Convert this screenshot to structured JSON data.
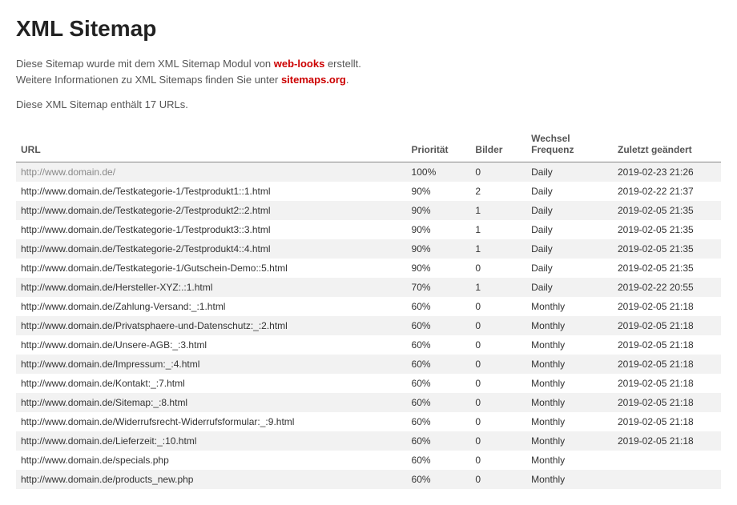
{
  "title": "XML Sitemap",
  "intro": {
    "line1_pre": "Diese Sitemap wurde mit dem XML Sitemap Modul von ",
    "link1": "web-looks",
    "line1_post": " erstellt.",
    "line2_pre": "Weitere Informationen zu XML Sitemaps finden Sie unter ",
    "link2": "sitemaps.org",
    "line2_post": "."
  },
  "count_text": "Diese XML Sitemap enthält 17 URLs.",
  "columns": {
    "url": "URL",
    "priority": "Priorität",
    "bilder": "Bilder",
    "freq": "Wechsel Frequenz",
    "changed": "Zuletzt geändert"
  },
  "rows": [
    {
      "url": "http://www.domain.de/",
      "priority": "100%",
      "bilder": "0",
      "freq": "Daily",
      "changed": "2019-02-23 21:26"
    },
    {
      "url": "http://www.domain.de/Testkategorie-1/Testprodukt1::1.html",
      "priority": "90%",
      "bilder": "2",
      "freq": "Daily",
      "changed": "2019-02-22 21:37"
    },
    {
      "url": "http://www.domain.de/Testkategorie-2/Testprodukt2::2.html",
      "priority": "90%",
      "bilder": "1",
      "freq": "Daily",
      "changed": "2019-02-05 21:35"
    },
    {
      "url": "http://www.domain.de/Testkategorie-1/Testprodukt3::3.html",
      "priority": "90%",
      "bilder": "1",
      "freq": "Daily",
      "changed": "2019-02-05 21:35"
    },
    {
      "url": "http://www.domain.de/Testkategorie-2/Testprodukt4::4.html",
      "priority": "90%",
      "bilder": "1",
      "freq": "Daily",
      "changed": "2019-02-05 21:35"
    },
    {
      "url": "http://www.domain.de/Testkategorie-1/Gutschein-Demo::5.html",
      "priority": "90%",
      "bilder": "0",
      "freq": "Daily",
      "changed": "2019-02-05 21:35"
    },
    {
      "url": "http://www.domain.de/Hersteller-XYZ:.:1.html",
      "priority": "70%",
      "bilder": "1",
      "freq": "Daily",
      "changed": "2019-02-22 20:55"
    },
    {
      "url": "http://www.domain.de/Zahlung-Versand:_:1.html",
      "priority": "60%",
      "bilder": "0",
      "freq": "Monthly",
      "changed": "2019-02-05 21:18"
    },
    {
      "url": "http://www.domain.de/Privatsphaere-und-Datenschutz:_:2.html",
      "priority": "60%",
      "bilder": "0",
      "freq": "Monthly",
      "changed": "2019-02-05 21:18"
    },
    {
      "url": "http://www.domain.de/Unsere-AGB:_:3.html",
      "priority": "60%",
      "bilder": "0",
      "freq": "Monthly",
      "changed": "2019-02-05 21:18"
    },
    {
      "url": "http://www.domain.de/Impressum:_:4.html",
      "priority": "60%",
      "bilder": "0",
      "freq": "Monthly",
      "changed": "2019-02-05 21:18"
    },
    {
      "url": "http://www.domain.de/Kontakt:_:7.html",
      "priority": "60%",
      "bilder": "0",
      "freq": "Monthly",
      "changed": "2019-02-05 21:18"
    },
    {
      "url": "http://www.domain.de/Sitemap:_:8.html",
      "priority": "60%",
      "bilder": "0",
      "freq": "Monthly",
      "changed": "2019-02-05 21:18"
    },
    {
      "url": "http://www.domain.de/Widerrufsrecht-Widerrufsformular:_:9.html",
      "priority": "60%",
      "bilder": "0",
      "freq": "Monthly",
      "changed": "2019-02-05 21:18"
    },
    {
      "url": "http://www.domain.de/Lieferzeit:_:10.html",
      "priority": "60%",
      "bilder": "0",
      "freq": "Monthly",
      "changed": "2019-02-05 21:18"
    },
    {
      "url": "http://www.domain.de/specials.php",
      "priority": "60%",
      "bilder": "0",
      "freq": "Monthly",
      "changed": ""
    },
    {
      "url": "http://www.domain.de/products_new.php",
      "priority": "60%",
      "bilder": "0",
      "freq": "Monthly",
      "changed": ""
    }
  ]
}
